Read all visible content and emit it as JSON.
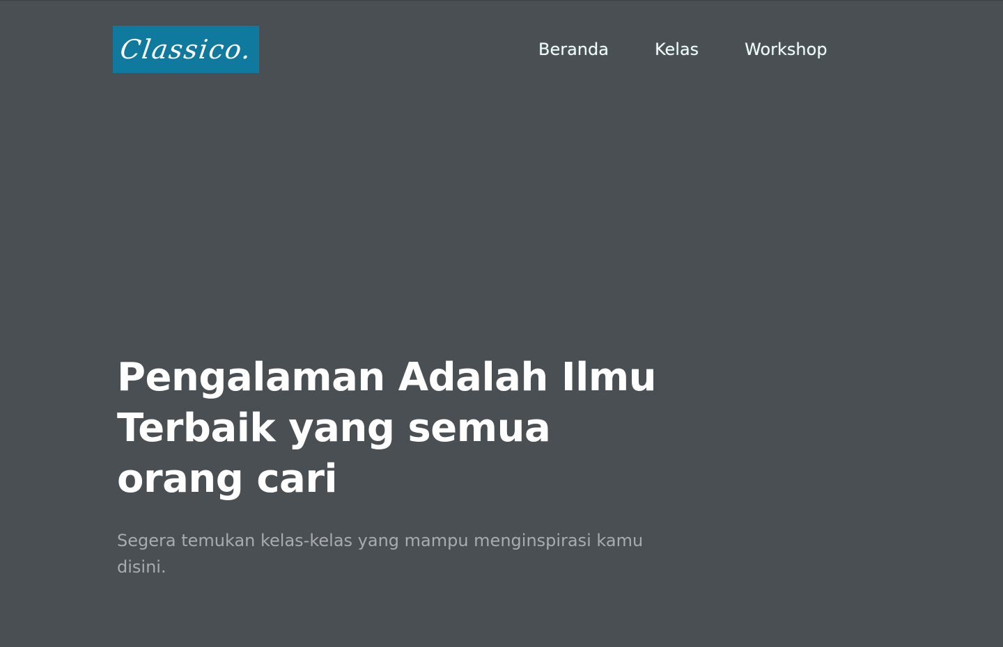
{
  "header": {
    "logo_text": "Classico.",
    "nav": [
      {
        "label": "Beranda"
      },
      {
        "label": "Kelas"
      },
      {
        "label": "Workshop"
      }
    ]
  },
  "hero": {
    "title": "Pengalaman Adalah Ilmu Terbaik yang semua orang cari",
    "subtitle": "Segera temukan kelas-kelas yang mampu menginspirasi kamu disini."
  },
  "colors": {
    "background": "#4a4f54",
    "logo_background": "#10799e",
    "text_primary": "#ffffff",
    "text_muted": "#a8acb0"
  }
}
